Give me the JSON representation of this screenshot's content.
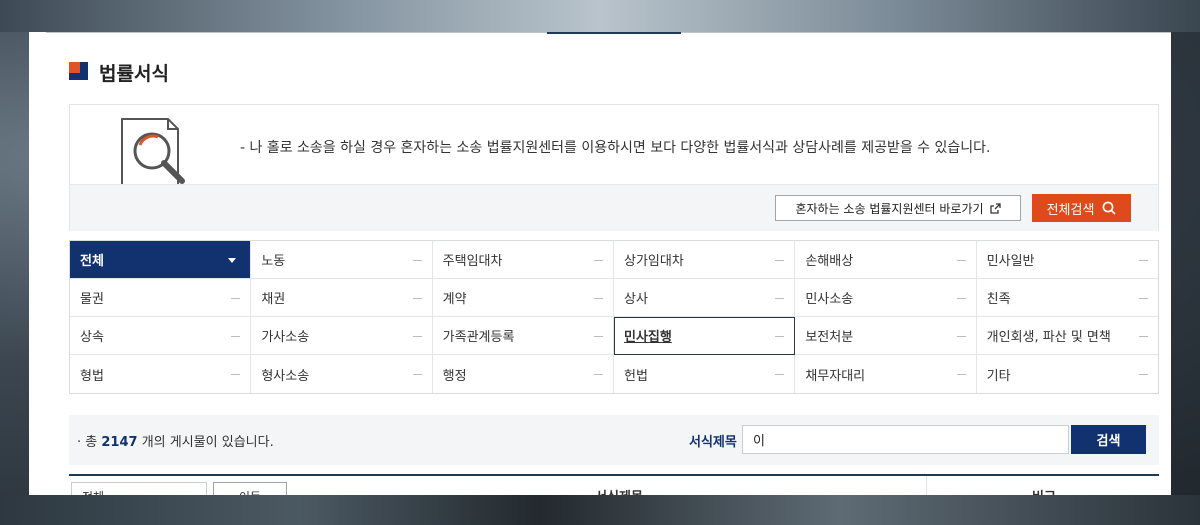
{
  "page": {
    "title": "법률서식"
  },
  "info": {
    "text": "- 나 홀로 소송을 하실 경우 혼자하는 소송 법률지원센터를 이용하시면 보다 다양한 법률서식과 상담사례를 제공받을 수 있습니다.",
    "link_label": "혼자하는 소송 법률지원센터 바로가기",
    "search_all_label": "전체검색"
  },
  "categories": [
    "전체",
    "노동",
    "주택임대차",
    "상가임대차",
    "손해배상",
    "민사일반",
    "물권",
    "채권",
    "계약",
    "상사",
    "민사소송",
    "친족",
    "상속",
    "가사소송",
    "가족관계등록",
    "민사집행",
    "보전처분",
    "개인회생, 파산 및 면책",
    "형법",
    "형사소송",
    "행정",
    "헌법",
    "채무자대리",
    "기타"
  ],
  "active_category": "전체",
  "focused_category": "민사집행",
  "summary": {
    "prefix": "총",
    "count": "2147",
    "suffix": "개의 게시물이 있습니다.",
    "field_label": "서식제목",
    "field_value": "이",
    "search_label": "검색"
  },
  "table": {
    "select_value": "전체",
    "move_label": "이동",
    "col_title": "서식제목",
    "col_note": "비고"
  },
  "colors": {
    "brand_navy": "#12326f",
    "accent_orange": "#de4a1c"
  }
}
